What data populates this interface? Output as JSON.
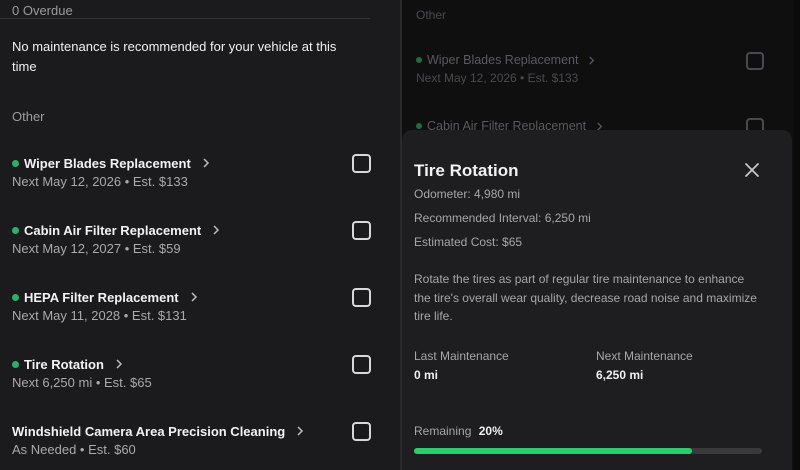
{
  "left": {
    "overdue_label": "0 Overdue",
    "notice": "No maintenance is recommended for your vehicle at this time",
    "other_label": "Other",
    "items": [
      {
        "name": "Wiper Blades Replacement",
        "sub": "Next May 12, 2026 • Est. $133",
        "dot": true
      },
      {
        "name": "Cabin Air Filter Replacement",
        "sub": "Next May 12, 2027 • Est. $59",
        "dot": true
      },
      {
        "name": "HEPA Filter Replacement",
        "sub": "Next May 11, 2028 • Est. $131",
        "dot": true
      },
      {
        "name": "Tire Rotation",
        "sub": "Next 6,250 mi • Est. $65",
        "dot": true
      },
      {
        "name": "Windshield Camera Area Precision Cleaning",
        "sub": "As Needed • Est. $60",
        "dot": false
      }
    ]
  },
  "right_bg": {
    "other_label": "Other",
    "items": [
      {
        "name": "Wiper Blades Replacement",
        "sub": "Next May 12, 2026 • Est. $133"
      },
      {
        "name": "Cabin Air Filter Replacement",
        "sub": ""
      }
    ]
  },
  "modal": {
    "title": "Tire Rotation",
    "odometer": "Odometer: 4,980 mi",
    "interval": "Recommended Interval: 6,250 mi",
    "cost": "Estimated Cost: $65",
    "description": "Rotate the tires as part of regular tire maintenance to enhance the tire's overall wear quality, decrease road noise and maximize tire life.",
    "last_label": "Last Maintenance",
    "last_value": "0 mi",
    "next_label": "Next Maintenance",
    "next_value": "6,250 mi",
    "remaining_label": "Remaining",
    "remaining_value": "20%",
    "remaining_fraction": 0.8
  },
  "colors": {
    "accent_green": "#2ecc71",
    "status_dot": "#27b26a"
  },
  "icons": {
    "item_arrow": "chevron-right-icon",
    "close": "close-icon",
    "status": "status-dot-icon",
    "checkbox": "checkbox-icon"
  }
}
